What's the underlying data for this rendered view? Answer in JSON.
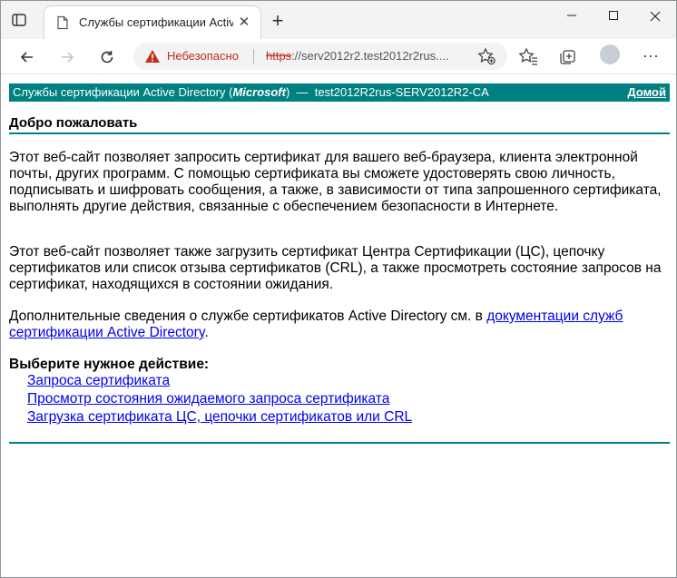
{
  "browser": {
    "tab_title": "Службы сертификации Active Directory",
    "security_label": "Небезопасно",
    "url_scheme": "https",
    "url_rest": "://serv2012r2.test2012r2rus....",
    "new_tab_symbol": "+"
  },
  "page": {
    "header": {
      "service_prefix": "Службы сертификации Active Directory (",
      "vendor": "Microsoft",
      "service_suffix": ")",
      "separator": "—",
      "ca_name": "test2012R2rus-SERV2012R2-CA",
      "home_link": "Домой"
    },
    "welcome_heading": "Добро пожаловать",
    "paragraph1": "Этот веб-сайт позволяет запросить сертификат для вашего веб-браузера, клиента электронной почты, других программ. С помощью сертификата вы сможете удостоверять свою личность, подписывать и шифровать сообщения, а также, в зависимости от типа запрошенного сертификата, выполнять другие действия, связанные с обеспечением безопасности в Интернете.",
    "paragraph2": "Этот веб-сайт позволяет также загрузить сертификат Центра Сертификации (ЦС), цепочку сертификатов или список отзыва сертификатов (CRL), а также просмотреть состояние запросов на сертификат, находящихся в состоянии ожидания.",
    "paragraph3_text": "Дополнительные сведения о службе сертификатов Active Directory см. в ",
    "paragraph3_link": "документации служб сертификации Active Directory",
    "paragraph3_end": ".",
    "choose_action": "Выберите нужное действие:",
    "actions": [
      "Запроса сертификата",
      "Просмотр состояния ожидаемого запроса сертификата",
      "Загрузка сертификата ЦС, цепочки сертификатов или CRL"
    ]
  },
  "colors": {
    "accent": "#008080",
    "link": "#0000ee",
    "warning": "#c42b1c"
  }
}
